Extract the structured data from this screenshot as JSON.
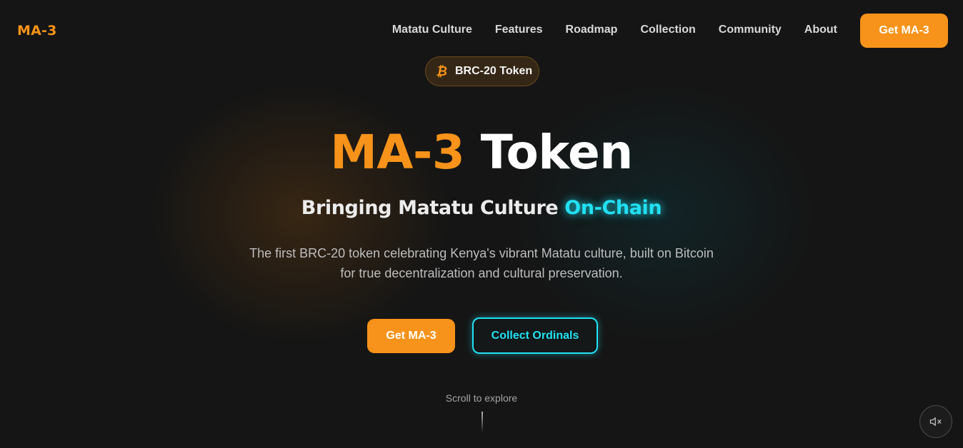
{
  "nav": {
    "logo": "MA-3",
    "links": [
      "Matatu Culture",
      "Features",
      "Roadmap",
      "Collection",
      "Community",
      "About"
    ],
    "cta_label": "Get MA-3"
  },
  "badge": {
    "icon": "bitcoin-icon",
    "label": "BRC-20 Token"
  },
  "hero": {
    "title_accent": "MA-3",
    "title_rest": "Token",
    "subtitle_plain": "Bringing Matatu Culture",
    "subtitle_glow": "On-Chain",
    "description": "The first BRC-20 token celebrating Kenya's vibrant Matatu culture, built on Bitcoin for true decentralization and cultural preservation.",
    "primary_button": "Get MA-3",
    "secondary_button": "Collect Ordinals"
  },
  "scroll": {
    "label": "Scroll to explore"
  },
  "sound": {
    "icon": "volume-muted-icon"
  },
  "colors": {
    "accent_orange": "#f7931a",
    "accent_cyan": "#22e0f2",
    "background": "#151515"
  }
}
